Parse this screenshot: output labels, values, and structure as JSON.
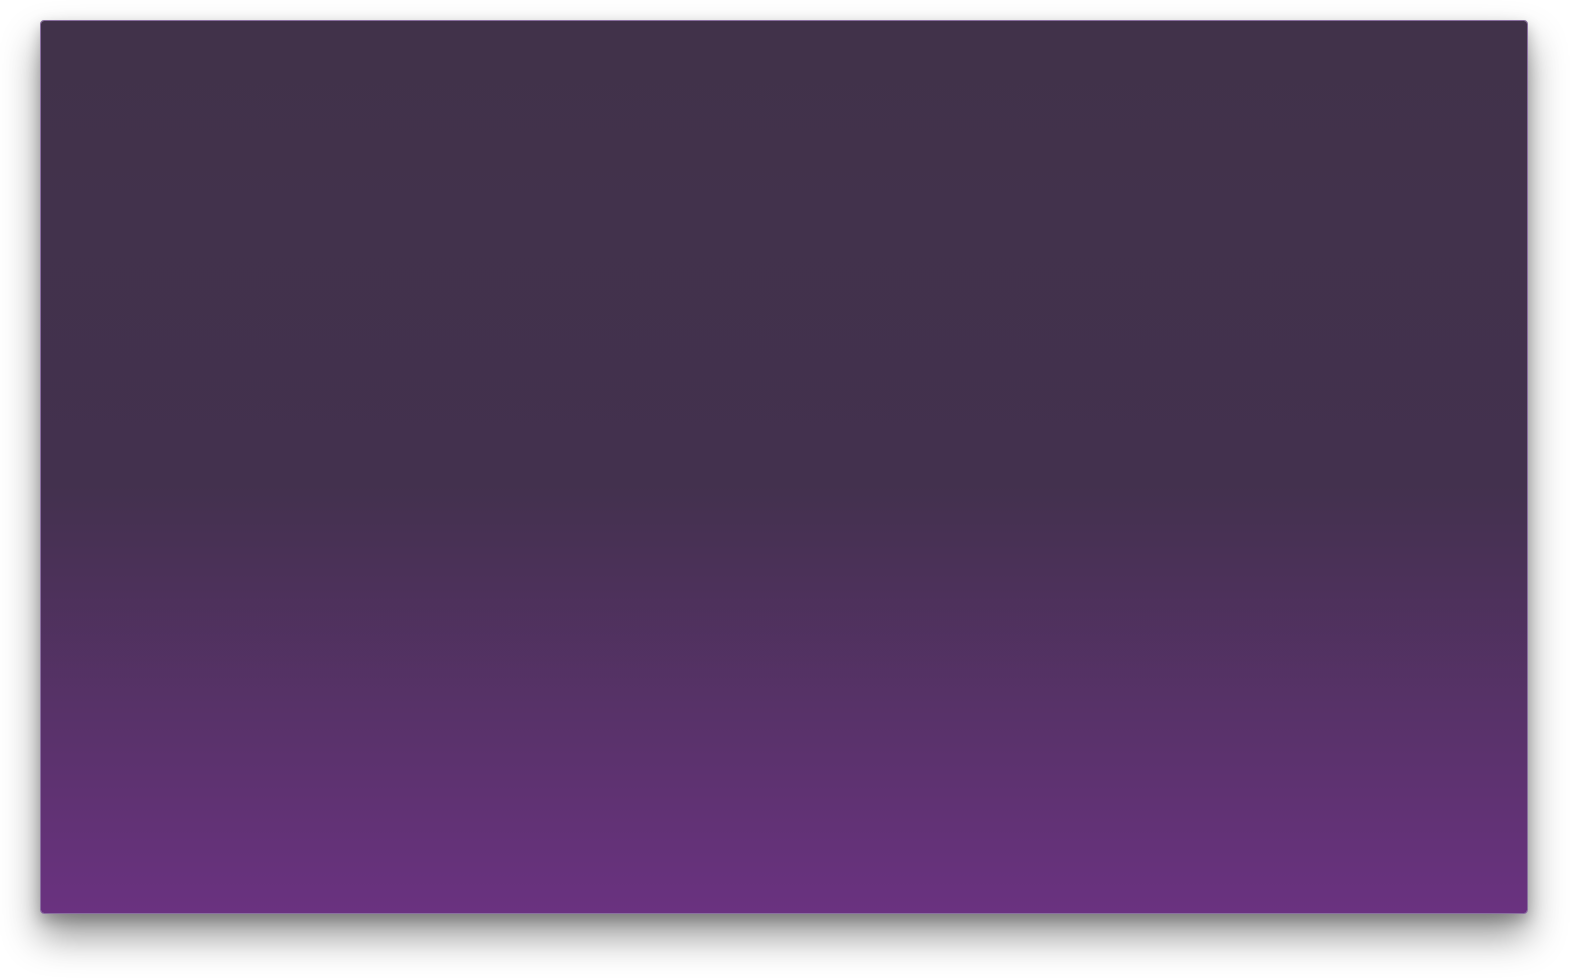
{
  "window": {
    "title": ""
  },
  "canvas": {
    "background_colors": {
      "top": "#41324A",
      "middle": "#43314E",
      "bottom": "#6A3280"
    }
  }
}
